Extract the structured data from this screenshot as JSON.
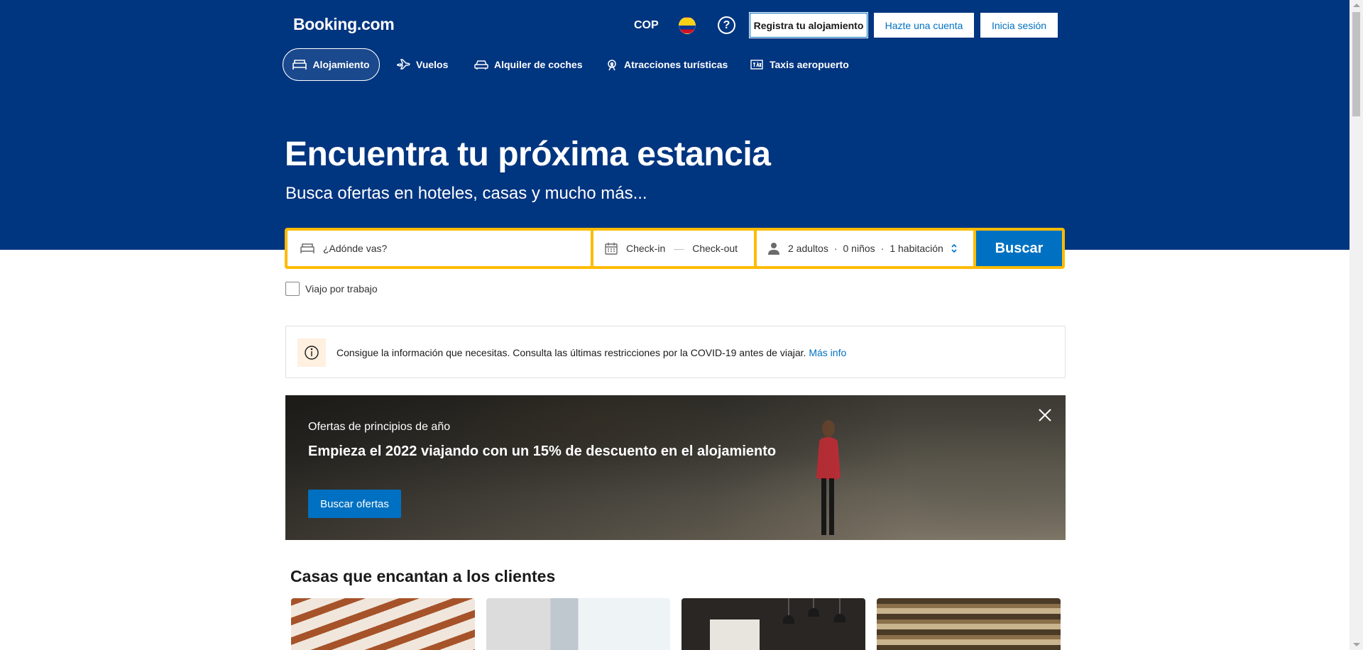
{
  "header": {
    "logo": "Booking.com",
    "currency": "COP",
    "help_icon_glyph": "?",
    "register_label": "Registra tu alojamiento",
    "create_account_label": "Hazte una cuenta",
    "login_label": "Inicia sesión"
  },
  "nav": [
    {
      "label": "Alojamiento",
      "icon": "bed-icon",
      "active": true
    },
    {
      "label": "Vuelos",
      "icon": "plane-icon",
      "active": false
    },
    {
      "label": "Alquiler de coches",
      "icon": "car-icon",
      "active": false
    },
    {
      "label": "Atracciones turísticas",
      "icon": "attractions-icon",
      "active": false
    },
    {
      "label": "Taxis aeropuerto",
      "icon": "taxi-icon",
      "active": false
    }
  ],
  "hero": {
    "title": "Encuentra tu próxima estancia",
    "subtitle": "Busca ofertas en hoteles, casas y mucho más..."
  },
  "search": {
    "destination_placeholder": "¿Adónde vas?",
    "checkin": "Check-in",
    "dash": "—",
    "checkout": "Check-out",
    "adults": "2 adultos",
    "children": "0 niños",
    "rooms": "1 habitación",
    "separator": "·",
    "button": "Buscar",
    "business_trip_label": "Viajo por trabajo",
    "business_trip_checked": false
  },
  "info": {
    "text": "Consigue la información que necesitas. Consulta las últimas restricciones por la COVID-19 antes de viajar.",
    "link": "Más info"
  },
  "promo": {
    "kicker": "Ofertas de principios de año",
    "title": "Empieza el 2022 viajando con un 15% de descuento en el alojamiento",
    "button": "Buscar ofertas"
  },
  "homes": {
    "title": "Casas que encantan a los clientes"
  },
  "colors": {
    "brand_blue": "#003580",
    "action_blue": "#0071c2",
    "search_yellow": "#febb02"
  }
}
